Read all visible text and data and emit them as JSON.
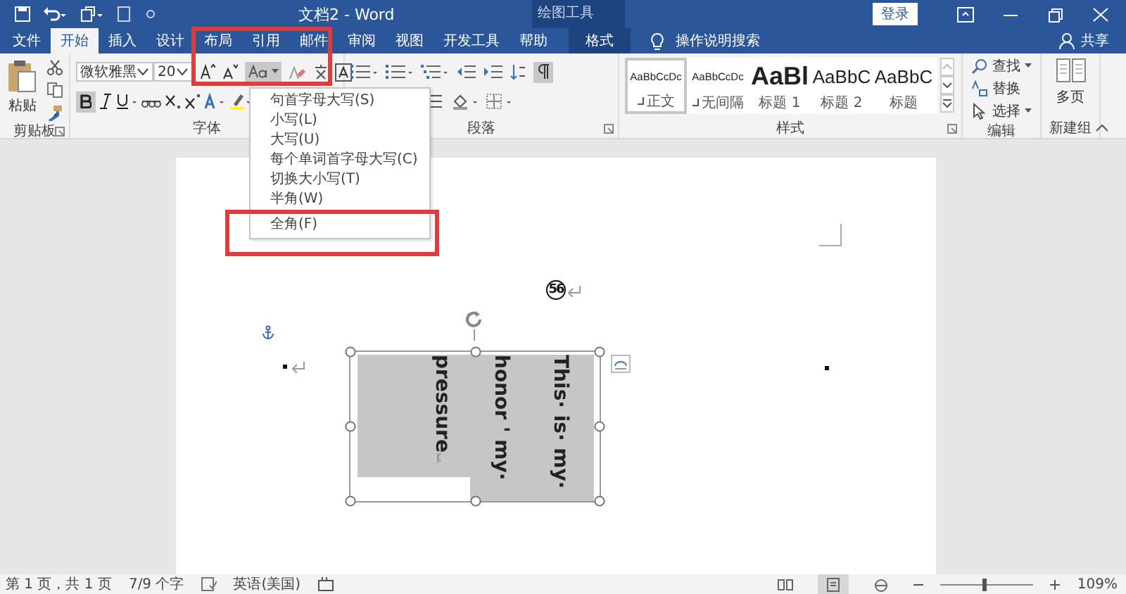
{
  "title_bar": {
    "title": "文档2 - Word",
    "context_label": "绘图工具",
    "sign_in": "登录"
  },
  "tabs": [
    {
      "label": "文件",
      "selected": false,
      "kind": "normal"
    },
    {
      "label": "开始",
      "selected": true,
      "kind": "normal"
    },
    {
      "label": "插入",
      "selected": false,
      "kind": "normal"
    },
    {
      "label": "设计",
      "selected": false,
      "kind": "normal"
    },
    {
      "label": "布局",
      "selected": false,
      "kind": "normal"
    },
    {
      "label": "引用",
      "selected": false,
      "kind": "normal"
    },
    {
      "label": "邮件",
      "selected": false,
      "kind": "normal"
    },
    {
      "label": "审阅",
      "selected": false,
      "kind": "normal"
    },
    {
      "label": "视图",
      "selected": false,
      "kind": "normal"
    },
    {
      "label": "开发工具",
      "selected": false,
      "kind": "normal"
    },
    {
      "label": "帮助",
      "selected": false,
      "kind": "normal"
    },
    {
      "label": "格式",
      "selected": false,
      "kind": "contextual"
    }
  ],
  "tell_me": "操作说明搜索",
  "share": "共享",
  "clipboard": {
    "paste": "粘贴",
    "label": "剪贴板"
  },
  "font": {
    "name": "微软雅黑",
    "size": "20",
    "label": "字体",
    "bold": true,
    "change_case_open": true
  },
  "paragraph": {
    "label": "段落",
    "show_marks": true
  },
  "styles": {
    "label": "样式",
    "items": [
      {
        "preview": "AaBbCcDc",
        "name": "正文",
        "kind": "small",
        "selected": true,
        "marker": true
      },
      {
        "preview": "AaBbCcDc",
        "name": "无间隔",
        "kind": "small",
        "selected": false,
        "marker": true
      },
      {
        "preview": "AaBl",
        "name": "标题 1",
        "kind": "large",
        "selected": false,
        "marker": false
      },
      {
        "preview": "AaBbC",
        "name": "标题 2",
        "kind": "medium",
        "selected": false,
        "marker": false
      },
      {
        "preview": "AaBbC",
        "name": "标题",
        "kind": "medium",
        "selected": false,
        "marker": false
      }
    ]
  },
  "editing": {
    "label": "编辑",
    "items": [
      {
        "label": "查找",
        "kind": "find"
      },
      {
        "label": "替换",
        "kind": "replace"
      },
      {
        "label": "选择",
        "kind": "select"
      }
    ]
  },
  "new_group": {
    "button": "多页",
    "label": "新建组"
  },
  "change_case_menu": [
    {
      "label": "句首字母大写(S)"
    },
    {
      "label": "小写(L)"
    },
    {
      "label": "大写(U)"
    },
    {
      "label": "每个单词首字母大写(C)"
    },
    {
      "label": "切换大小写(T)"
    },
    {
      "label": "半角(W)"
    },
    {
      "label": "全角(F)"
    }
  ],
  "document": {
    "circled_number": "56",
    "text_box_lines": [
      "This· is· my·",
      "honor ' my·",
      "pressure"
    ]
  },
  "status_bar": {
    "page": "第 1 页，共 1 页",
    "words": "7/9 个字",
    "language": "英语(美国)",
    "views": [
      {
        "selected": false
      },
      {
        "selected": true
      },
      {
        "selected": false
      }
    ],
    "zoom": {
      "level": 0.47
    },
    "zoom_text": "109%"
  }
}
